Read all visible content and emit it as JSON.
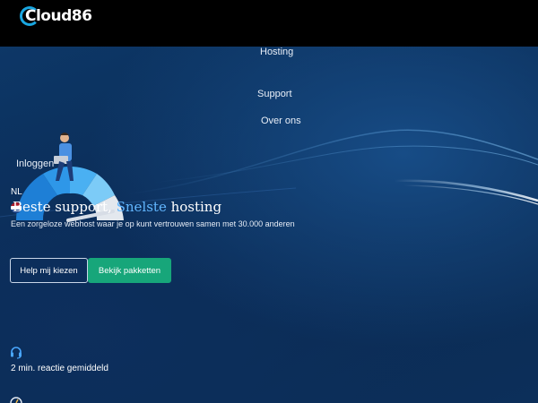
{
  "brand": {
    "name": "Cloud86",
    "accent_color": "#19a6e0",
    "cta_color": "#17a67a"
  },
  "nav": {
    "hosting": "Hosting",
    "support": "Support",
    "about": "Over ons",
    "login": "Inloggen",
    "language": "NL"
  },
  "hero": {
    "headline_part1": "Beste support, ",
    "headline_accent": "Snelste",
    "headline_part2": " hosting",
    "subline": "Een zorgeloze webhost waar je op kunt vertrouwen samen met 30.000 anderen",
    "button_help": "Help mij kiezen",
    "button_packages": "Bekijk pakketten"
  },
  "stats": {
    "support_icon": "headset-icon",
    "support_text": "2 min. reactie gemiddeld",
    "second_icon": "speed-icon"
  }
}
